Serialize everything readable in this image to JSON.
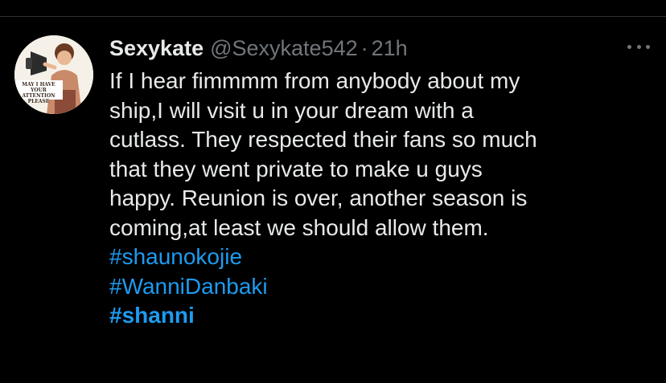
{
  "tweet": {
    "author": {
      "display_name": "Sexykate",
      "handle": "@Sexykate542",
      "avatar_text": "MAY I HAVE YOUR ATTENTION PLEASE"
    },
    "separator": "·",
    "time": "21h",
    "body_lines": [
      "If I hear fimmmm from anybody about my",
      "ship,I will visit u in your dream with a",
      "cutlass. They respected their fans so much",
      "that they went private to make u guys",
      "happy. Reunion is over, another season is",
      "coming,at least we should allow them."
    ],
    "hashtags": [
      "#shaunokojie",
      "#WanniDanbaki",
      "#shanni"
    ]
  },
  "colors": {
    "background": "#000000",
    "text": "#e7e9ea",
    "muted": "#71767b",
    "link": "#1d9bf0",
    "divider": "#2f3336"
  },
  "icons": {
    "more": "more-horizontal-icon"
  }
}
